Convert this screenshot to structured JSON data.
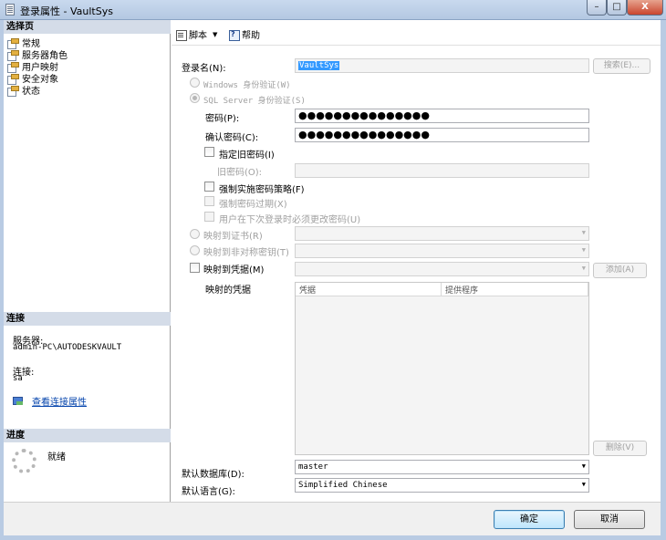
{
  "window": {
    "title": "登录属性 - VaultSys",
    "min": "–",
    "max": "□",
    "close": "X"
  },
  "left": {
    "select_page_header": "选择页",
    "pages": [
      "常规",
      "服务器角色",
      "用户映射",
      "安全对象",
      "状态"
    ],
    "connection_header": "连接",
    "server_label": "服务器:",
    "server_value": "admin-PC\\AUTODESKVAULT",
    "connection_label": "连接:",
    "connection_value": "sa",
    "view_conn_props": "查看连接属性",
    "progress_header": "进度",
    "progress_status": "就绪"
  },
  "toolbar": {
    "script_label": "脚本",
    "help_label": "帮助"
  },
  "form": {
    "login_name_label": "登录名(N):",
    "login_name_value": "VaultSys",
    "search_button": "搜索(E)...",
    "windows_auth": "Windows 身份验证(W)",
    "sql_auth": "SQL Server 身份验证(S)",
    "password_label": "密码(P):",
    "password_value": "●●●●●●●●●●●●●●●",
    "confirm_password_label": "确认密码(C):",
    "confirm_password_value": "●●●●●●●●●●●●●●●",
    "specify_old_password": "指定旧密码(I)",
    "old_password_label": "旧密码(O):",
    "enforce_policy": "强制实施密码策略(F)",
    "enforce_expiration": "强制密码过期(X)",
    "must_change": "用户在下次登录时必须更改密码(U)",
    "map_to_cert": "映射到证书(R)",
    "map_to_asym_key": "映射到非对称密钥(T)",
    "map_to_credential": "映射到凭据(M)",
    "add_button": "添加(A)",
    "mapped_credentials_label": "映射的凭据",
    "grid_columns": [
      "凭据",
      "提供程序"
    ],
    "remove_button": "删除(V)",
    "default_db_label": "默认数据库(D):",
    "default_db_value": "master",
    "default_lang_label": "默认语言(G):",
    "default_lang_value": "Simplified Chinese"
  },
  "dialog": {
    "ok_label": "确定",
    "cancel_label": "取消"
  },
  "icons": {
    "app": "document-icon",
    "page": "page-icon",
    "script": "script-icon",
    "help": "help-icon",
    "connection": "connection-properties-icon",
    "progress": "spinner-icon",
    "dropdown": "chevron-down-icon"
  }
}
